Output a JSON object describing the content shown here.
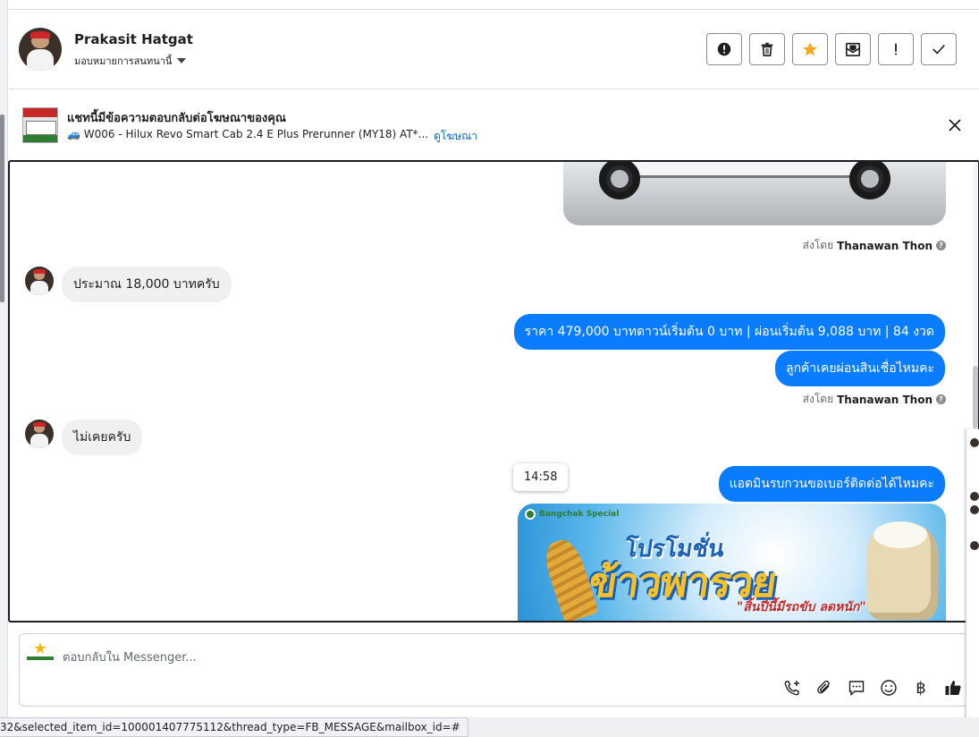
{
  "contact": {
    "name": "Prakasit Hatgat",
    "assign_label": "มอบหมายการสนทนานี้"
  },
  "actions": [
    {
      "name": "spam-report-button",
      "icon": "alert-circle-icon"
    },
    {
      "name": "delete-button",
      "icon": "trash-icon"
    },
    {
      "name": "star-button",
      "icon": "star-icon"
    },
    {
      "name": "mark-unread-button",
      "icon": "mail-icon"
    },
    {
      "name": "follow-up-button",
      "icon": "exclamation-icon"
    },
    {
      "name": "done-button",
      "icon": "check-icon"
    }
  ],
  "ad_banner": {
    "title": "แชทนี้มีข้อความตอบกลับต่อโฆษณาของคุณ",
    "subtitle": "🚙 W006 - Hilux Revo Smart Cab 2.4 E Plus Prerunner (MY18) AT*...",
    "link": "ดูโฆษณา"
  },
  "messages": {
    "sent_by_prefix": "ส่งโดย",
    "sent_by_name": "Thanawan Thon",
    "help_mark": "?",
    "incoming_1": "ประมาณ 18,000 บาทครับ",
    "outgoing_1": "ราคา 479,000 บาทดาวน์เริ่มต้น 0 บาท | ผ่อนเริ่มต้น 9,088 บาท | 84 งวด",
    "outgoing_2": "ลูกค้าเคยผ่อนสินเชื่อไหมคะ",
    "incoming_2": "ไม่เคยครับ",
    "outgoing_3": "แอดมินรบกวนขอเบอร์ติดต่อได้ไหมคะ",
    "timestamp": "14:58"
  },
  "promo": {
    "logo_text": "Bangchak Special",
    "line1": "โปรโมชั่น",
    "line2": "ข้าวพารวย",
    "line3": "\"สิ้นปีนี้มีรถขับ ลดหนัก\""
  },
  "composer": {
    "placeholder": "ตอบกลับใน Messenger...",
    "tools": [
      "call-add-icon",
      "paperclip-icon",
      "chat-bubble-icon",
      "emoji-icon",
      "baht-icon",
      "thumbs-up-icon"
    ],
    "baht_symbol": "฿"
  },
  "status_bar": {
    "url": "32&selected_item_id=100001407775112&thread_type=FB_MESSAGE&mailbox_id=#"
  },
  "colors": {
    "outgoing_bubble": "#0a7cff",
    "incoming_bubble": "#f0f0f0",
    "star": "#f5a623",
    "link": "#0a66c2"
  }
}
